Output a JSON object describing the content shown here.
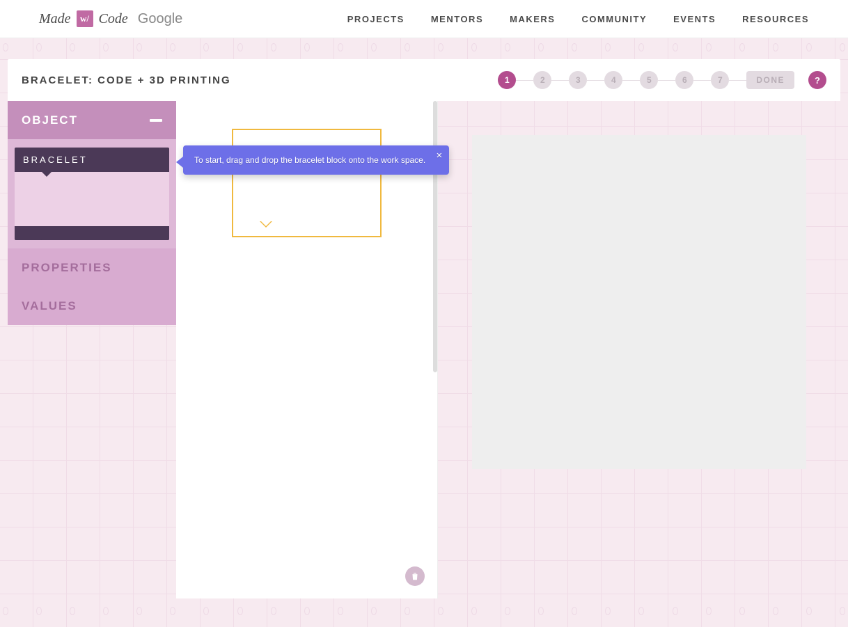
{
  "logo": {
    "text1": "Made",
    "box": "w/",
    "text2": "Code",
    "google": "Google"
  },
  "nav": {
    "projects": "PROJECTS",
    "mentors": "MENTORS",
    "makers": "MAKERS",
    "community": "COMMUNITY",
    "events": "EVENTS",
    "resources": "RESOURCES"
  },
  "project_title": "BRACELET: CODE + 3D PRINTING",
  "steps": {
    "s1": "1",
    "s2": "2",
    "s3": "3",
    "s4": "4",
    "s5": "5",
    "s6": "6",
    "s7": "7",
    "done": "DONE"
  },
  "help": "?",
  "sidebar": {
    "object_label": "OBJECT",
    "block_name": "BRACELET",
    "properties_label": "PROPERTIES",
    "values_label": "VALUES"
  },
  "tooltip": {
    "text": "To start, drag and drop the bracelet block onto the work space.",
    "close": "×"
  }
}
